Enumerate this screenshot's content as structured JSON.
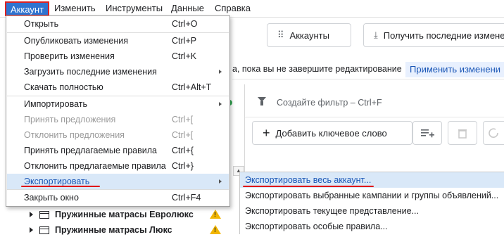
{
  "menubar": {
    "items": [
      "Аккаунт",
      "Изменить",
      "Инструменты",
      "Данные",
      "Справка"
    ]
  },
  "toolbar": {
    "accounts_label": "Аккаунты",
    "get_changes_label": "Получить последние измене"
  },
  "notice": {
    "text": "а, пока вы не завершите редактирование",
    "apply_label": "Применить изменени"
  },
  "filter": {
    "placeholder": "Создайте фильтр – Ctrl+F"
  },
  "keywords": {
    "add_label": "Добавить ключевое слово"
  },
  "tree": {
    "rows": [
      "Пружинные матрасы Евролюкс",
      "Пружинные матрасы Люкс"
    ]
  },
  "dropdown": {
    "items": [
      {
        "label": "Открыть",
        "shortcut": "Ctrl+O"
      },
      {
        "label": "Опубликовать изменения",
        "shortcut": "Ctrl+P"
      },
      {
        "label": "Проверить изменения",
        "shortcut": "Ctrl+K"
      },
      {
        "label": "Загрузить последние изменения",
        "shortcut": ""
      },
      {
        "label": "Скачать полностью",
        "shortcut": "Ctrl+Alt+T"
      },
      {
        "label": "Импортировать",
        "shortcut": ""
      },
      {
        "label": "Принять предложения",
        "shortcut": "Ctrl+["
      },
      {
        "label": "Отклонить предложения",
        "shortcut": "Ctrl+["
      },
      {
        "label": "Принять предлагаемые правила",
        "shortcut": "Ctrl+{"
      },
      {
        "label": "Отклонить предлагаемые правила",
        "shortcut": "Ctrl+}"
      },
      {
        "label": "Экспортировать",
        "shortcut": ""
      },
      {
        "label": "Закрыть окно",
        "shortcut": "Ctrl+F4"
      }
    ]
  },
  "submenu": {
    "items": [
      "Экспортировать весь аккаунт...",
      "Экспортировать выбранные кампании и группы объявлений...",
      "Экспортировать текущее представление...",
      "Экспортировать особые правила..."
    ]
  },
  "colors": {
    "accent": "#2f74d0",
    "highlight": "#d9e8f8",
    "annotation": "#e01010",
    "warning": "#f2b600"
  }
}
